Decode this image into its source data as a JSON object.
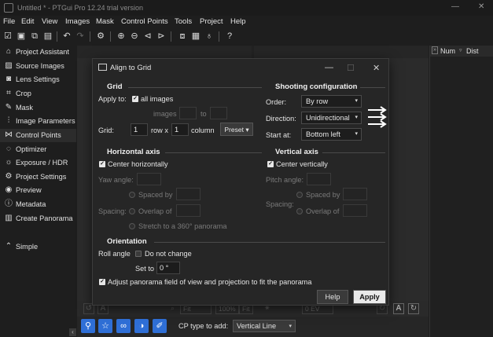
{
  "window": {
    "title": "Untitled * - PTGui Pro 12.24 trial version",
    "controls": [
      "—",
      "☐",
      "✕"
    ]
  },
  "menu": [
    "File",
    "Edit",
    "View",
    "Images",
    "Mask",
    "Control Points",
    "Tools",
    "Project",
    "Help"
  ],
  "toolbar": [
    "new-icon",
    "open-icon",
    "add-images-icon",
    "save-icon",
    "undo-icon",
    "redo-icon",
    "settings-icon",
    "zoom-in-icon",
    "zoom-out-icon",
    "prev-icon",
    "next-icon",
    "panorama-editor-icon",
    "table-icon",
    "light-icon",
    "help-icon"
  ],
  "sidebar": {
    "items": [
      {
        "label": "Project Assistant",
        "icon": "home-icon"
      },
      {
        "label": "Source Images",
        "icon": "image-icon"
      },
      {
        "label": "Lens Settings",
        "icon": "camera-icon"
      },
      {
        "label": "Crop",
        "icon": "crop-icon"
      },
      {
        "label": "Mask",
        "icon": "pen-icon"
      },
      {
        "label": "Image Parameters",
        "icon": "sliders-icon"
      },
      {
        "label": "Control Points",
        "icon": "control-points-icon"
      },
      {
        "label": "Optimizer",
        "icon": "optimizer-icon"
      },
      {
        "label": "Exposure / HDR",
        "icon": "sun-icon"
      },
      {
        "label": "Project Settings",
        "icon": "gear-icon"
      },
      {
        "label": "Preview",
        "icon": "eye-icon"
      },
      {
        "label": "Metadata",
        "icon": "info-icon"
      },
      {
        "label": "Create Panorama",
        "icon": "panorama-icon"
      }
    ],
    "active_index": 6,
    "simple": {
      "label": "Simple",
      "icon": "chevron-up-icon"
    }
  },
  "right_panel": {
    "col_num": "Num",
    "col_dist": "Dist"
  },
  "background_strip": {
    "fit1": "Fit",
    "zoom": "100%",
    "fit2": "Fit",
    "ev": "0 EV"
  },
  "bottom": {
    "cp_type_label": "CP type to add:",
    "cp_type_value": "Vertical Line"
  },
  "dialog": {
    "title": "Align to Grid",
    "grid": {
      "heading": "Grid",
      "apply_to_label": "Apply to:",
      "all_images_label": "all images",
      "all_images_checked": true,
      "images_label": "images",
      "to_label": "to",
      "grid_label": "Grid:",
      "rows": "1",
      "row_x_label": "row x",
      "cols": "1",
      "column_label": "column",
      "preset_label": "Preset ▾"
    },
    "shooting": {
      "heading": "Shooting configuration",
      "order_label": "Order:",
      "order_value": "By row",
      "direction_label": "Direction:",
      "direction_value": "Unidirectional",
      "start_label": "Start at:",
      "start_value": "Bottom left"
    },
    "horizontal": {
      "heading": "Horizontal axis",
      "center_label": "Center horizontally",
      "center_checked": true,
      "yaw_label": "Yaw angle:",
      "spacing_label": "Spacing:",
      "spaced_by": "Spaced by",
      "overlap_of": "Overlap of",
      "stretch": "Stretch to a 360° panorama"
    },
    "vertical": {
      "heading": "Vertical axis",
      "center_label": "Center vertically",
      "center_checked": true,
      "pitch_label": "Pitch angle:",
      "spacing_label": "Spacing:",
      "spaced_by": "Spaced by",
      "overlap_of": "Overlap of"
    },
    "orientation": {
      "heading": "Orientation",
      "roll_label": "Roll angle",
      "do_not_change": "Do not change",
      "set_to_label": "Set to",
      "set_to_value": "0 °"
    },
    "adjust_label": "Adjust panorama field of view and projection to fit the panorama",
    "adjust_checked": true,
    "help_label": "Help",
    "apply_label": "Apply"
  }
}
